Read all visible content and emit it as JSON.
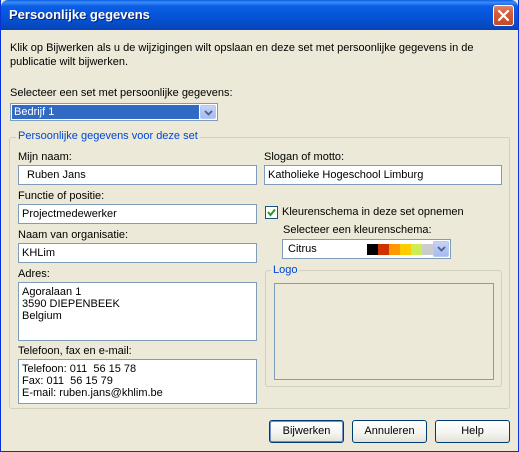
{
  "window": {
    "title": "Persoonlijke gegevens"
  },
  "intro_text": "Klik op Bijwerken als u de wijzigingen wilt opslaan en deze set met persoonlijke gegevens in de publicatie wilt bijwerken.",
  "set_select": {
    "label": "Selecteer een set met persoonlijke gegevens:",
    "value": "Bedrijf 1"
  },
  "group": {
    "legend": "Persoonlijke gegevens voor deze set"
  },
  "fields": {
    "name_label": "Mijn naam:",
    "name_value": "Ruben Jans",
    "function_label": "Functie of positie:",
    "function_value": "Projectmedewerker",
    "org_label": "Naam van organisatie:",
    "org_value": "KHLim",
    "address_label": "Adres:",
    "address_value": "Agoralaan 1\n3590 DIEPENBEEK\nBelgium",
    "contact_label": "Telefoon, fax en e-mail:",
    "contact_value": "Telefoon: 011  56 15 78\nFax: 011  56 15 79\nE-mail: ruben.jans@khlim.be",
    "slogan_label": "Slogan of motto:",
    "slogan_value": "Katholieke Hogeschool Limburg"
  },
  "color_scheme": {
    "checkbox_label": "Kleurenschema in deze set opnemen",
    "checked": true,
    "select_label": "Selecteer een kleurenschema:",
    "value": "Citrus",
    "swatches": [
      "#000000",
      "#cc3300",
      "#ff9900",
      "#ffcc00",
      "#ccee55",
      "#cccccc"
    ]
  },
  "logo": {
    "legend": "Logo"
  },
  "buttons": {
    "update": "Bijwerken",
    "cancel": "Annuleren",
    "help": "Help"
  },
  "colors": {
    "titlebar": "#0a5fe6",
    "dialog_bg": "#ece9d8",
    "group_legend": "#0046d5",
    "selection": "#316ac5"
  }
}
